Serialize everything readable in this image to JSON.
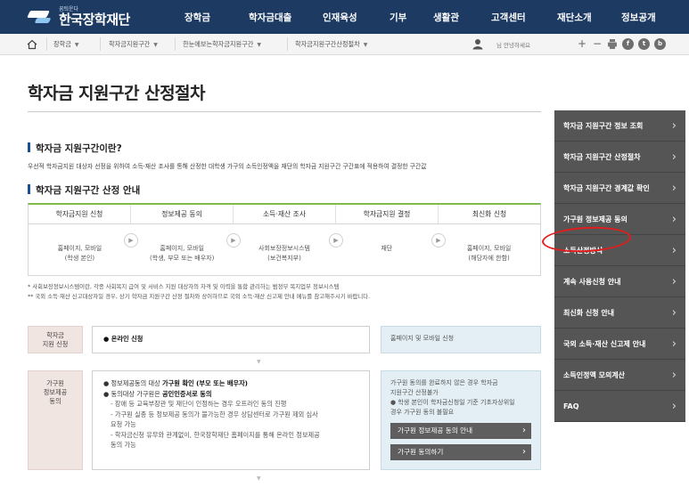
{
  "header": {
    "logo_small": "꿈틔운다",
    "logo_text": "한국장학재단",
    "menu": [
      "장학금",
      "학자금대출",
      "인재육성",
      "기부",
      "생활관",
      "고객센터",
      "재단소개",
      "정보공개"
    ]
  },
  "breadcrumb": {
    "items": [
      "장학금",
      "학자금지원구간",
      "한눈에보는학자금지원구간",
      "학자금지원구간산정절차"
    ],
    "greeting": "님 안녕하세요",
    "tools": [
      "+",
      "−"
    ],
    "social": [
      "f",
      "t",
      "b"
    ]
  },
  "page": {
    "title": "학자금 지원구간 산정절차"
  },
  "section1": {
    "heading": "학자금 지원구간이란?",
    "desc": "우선적 학자금지원 대상자 선정을 위하여 소득·재산 조사를 통해 산정한 대학생 가구의 소득인정액을 재단의 학자금 지원구간 구간표에 적용하여 결정한 구간값"
  },
  "section2": {
    "heading": "학자금 지원구간 산정 안내",
    "steps": [
      {
        "title": "학자금지원 신청",
        "line1": "홈페이지, 모바일",
        "line2": "(학생 본인)"
      },
      {
        "title": "정보제공 동의",
        "line1": "홈페이지, 모바일",
        "line2": "(학생, 부모 또는 배우자)"
      },
      {
        "title": "소득·재산 조사",
        "line1": "사회보장정보시스템",
        "line2": "(보건복지부)"
      },
      {
        "title": "학자금지원 결정",
        "line1": "재단",
        "line2": ""
      },
      {
        "title": "최신화 신청",
        "line1": "홈페이지, 모바일",
        "line2": "(해당자에 한함)"
      }
    ],
    "note1": "* 사회보장정보시스템이란, 각종 사회복지 급여 및 서비스 지원 대상자의 자격 및 이력을 통합 관리하는 범정부 복지업무 정보시스템",
    "note2": "** 국외 소득·재산 신고대상자일 경우, 상기 학자금 지원구간 산정 절차와 상이하므로 국외 소득·재산 신고제 안내 메뉴를 참고해주시기 바랍니다."
  },
  "step_rows": {
    "row1": {
      "label_line1": "학자금",
      "label_line2": "지원 신청",
      "main": "● 온라인 신청",
      "side": "홈페이지 및 모바일 신청"
    },
    "row2": {
      "label_line1": "가구원",
      "label_line2": "정보제공",
      "label_line3": "동의",
      "main_line1_a": "● 정보제공동의 대상 ",
      "main_line1_b": "가구원 확인 (부모 또는 배우자)",
      "main_line2_a": "● 동의대상 가구원은 ",
      "main_line2_b": "공인인증서로 동의",
      "sub1": "- 장애 등 교육부장관 및 재단이 인정하는 경우 오프라인 동의 진행",
      "sub2": "- 가구원 실종 등 정보제공 동의가 불가능한 경우 상담센터로 가구원 제외 심사",
      "sub2b": "요청 가능",
      "sub3": "- 학자금신청 유무와 관계없이, 한국장학재단 홈페이지를 통해 온라인 정보제공",
      "sub3b": "동의 가능",
      "side_line1": "가구원 동의를 완료하지 않은 경우 학자금",
      "side_line2": "지원구간 산정불가",
      "side_line3": "● 학생 본인이 학자금신청일 기준 기초자상위일",
      "side_line4": "경우 가구원 동의 불필요",
      "side_btn1": "가구원 정보제공 동의 안내",
      "side_btn2": "가구원 동의하기"
    }
  },
  "sidebar": {
    "items": [
      "학자금 지원구간 정보 조회",
      "학자금 지원구간 산정절차",
      "학자금 지원구간 경계값 확인",
      "가구원 정보제공 동의",
      "소득산정방식",
      "계속 사용신청 안내",
      "최신화 신청 안내",
      "국외 소득·재산 신고제 안내",
      "소득인정액 모의계산",
      "FAQ"
    ]
  }
}
